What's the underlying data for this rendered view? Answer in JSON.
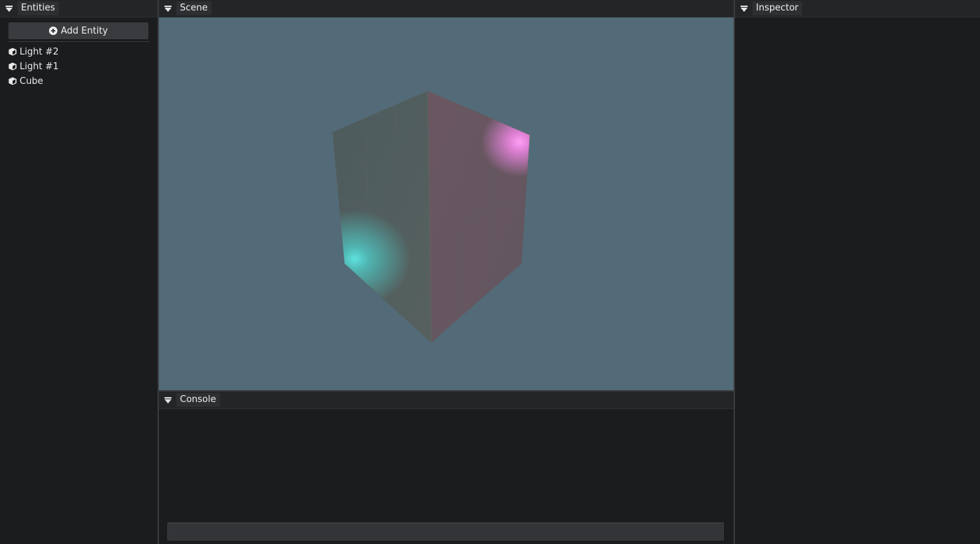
{
  "entities_panel": {
    "title": "Entities",
    "add_button_label": "Add Entity",
    "items": [
      {
        "label": "Light #2",
        "icon": "cube-icon"
      },
      {
        "label": "Light #1",
        "icon": "cube-icon"
      },
      {
        "label": "Cube",
        "icon": "cube-icon"
      }
    ]
  },
  "scene_panel": {
    "title": "Scene"
  },
  "console_panel": {
    "title": "Console",
    "input_value": ""
  },
  "inspector_panel": {
    "title": "Inspector"
  },
  "colors": {
    "viewport_background": "#536b78",
    "light_1": "#5fe3df",
    "light_2": "#ff8cf3",
    "panel_background": "#1b1c1e"
  }
}
